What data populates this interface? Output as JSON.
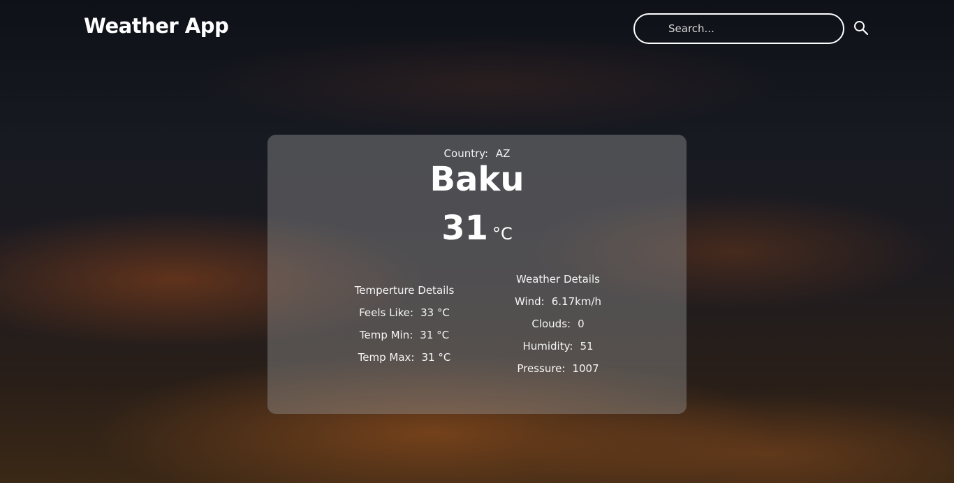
{
  "header": {
    "logo": "Weather App",
    "search_placeholder": "Search...",
    "search_icon": "search-icon"
  },
  "weather": {
    "country_label": "Country:",
    "country_code": "AZ",
    "city": "Baku",
    "temperature": "31",
    "temperature_unit": "°C",
    "temperature_details": {
      "title": "Temperture Details",
      "feels_like_label": "Feels Like:",
      "feels_like_value": "33 °C",
      "temp_min_label": "Temp Min:",
      "temp_min_value": "31 °C",
      "temp_max_label": "Temp Max:",
      "temp_max_value": "31 °C"
    },
    "weather_details": {
      "title": "Weather Details",
      "wind_label": "Wind:",
      "wind_value": "6.17km/h",
      "clouds_label": "Clouds:",
      "clouds_value": "0",
      "humidity_label": "Humidity:",
      "humidity_value": "51",
      "pressure_label": "Pressure:",
      "pressure_value": "1007"
    }
  }
}
